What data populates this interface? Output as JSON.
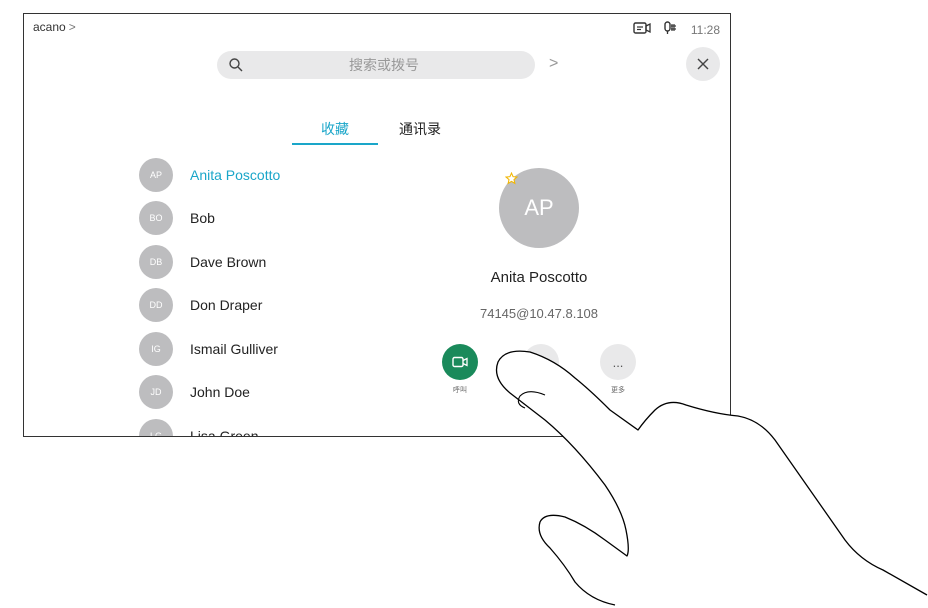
{
  "topbar": {
    "breadcrumb": "acano",
    "breadcrumb_chevron": ">",
    "time": "11:28"
  },
  "icons": {
    "camera": "camera-icon",
    "mic": "microphone-icon",
    "search": "search-icon",
    "close": "close-icon",
    "star": "star-icon",
    "video": "video-call-icon",
    "more": "more-icon"
  },
  "search": {
    "placeholder": "搜索或拨号",
    "next": ">"
  },
  "tabs": [
    {
      "label": "收藏",
      "active": true
    },
    {
      "label": "通讯录",
      "active": false
    }
  ],
  "contacts": [
    {
      "initials": "AP",
      "name": "Anita Poscotto",
      "selected": true
    },
    {
      "initials": "BO",
      "name": "Bob"
    },
    {
      "initials": "DB",
      "name": "Dave Brown"
    },
    {
      "initials": "DD",
      "name": "Don Draper"
    },
    {
      "initials": "IG",
      "name": "Ismail Gulliver"
    },
    {
      "initials": "JD",
      "name": "John Doe"
    },
    {
      "initials": "LG",
      "name": "Lisa Green"
    }
  ],
  "detail": {
    "initials": "AP",
    "name": "Anita Poscotto",
    "uri": "74145@10.47.8.108",
    "actions": [
      {
        "label": "呼叫"
      },
      {
        "label": ""
      },
      {
        "symbol": "...",
        "label": "更多"
      }
    ]
  },
  "colors": {
    "accent": "#1aa6c9",
    "call_green": "#1a8a5b",
    "avatar_grey": "#bdbdbf",
    "star": "#f2b705"
  }
}
